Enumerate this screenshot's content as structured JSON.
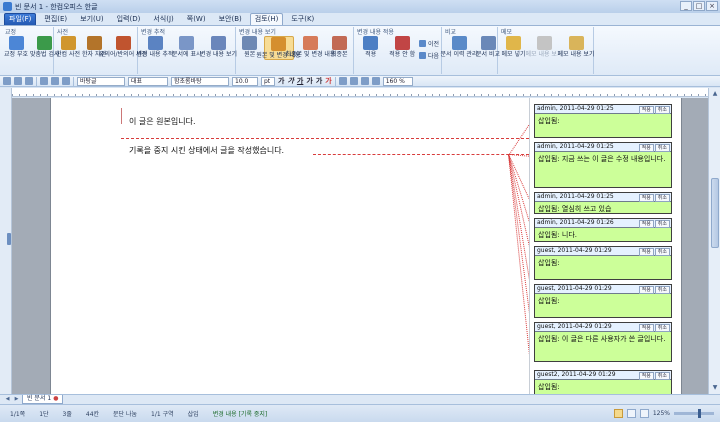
{
  "window": {
    "title": "빈 문서 1 - 한컴오피스 한글",
    "controls": [
      "_",
      "□",
      "×"
    ]
  },
  "menu": [
    {
      "label": "파일(F)",
      "kind": "file"
    },
    {
      "label": "편집(E)"
    },
    {
      "label": "보기(U)"
    },
    {
      "label": "입력(D)"
    },
    {
      "label": "서식(J)"
    },
    {
      "label": "쪽(W)"
    },
    {
      "label": "보안(B)"
    },
    {
      "label": "검토(H)",
      "kind": "active"
    },
    {
      "label": "도구(K)"
    }
  ],
  "ribbon": {
    "groups": [
      {
        "label": "교정",
        "buttons": [
          {
            "label": "교정 부호",
            "icon": "proof-mark-icon",
            "color": "#4c86d6"
          },
          {
            "label": "맞춤법 검사",
            "icon": "spellcheck-icon",
            "color": "#3b9a4a"
          }
        ]
      },
      {
        "label": "사전",
        "buttons": [
          {
            "label": "한컴 사전",
            "icon": "dictionary-icon",
            "color": "#d0962e"
          },
          {
            "label": "한자 자전",
            "icon": "hanja-dictionary-icon",
            "color": "#b3742a"
          },
          {
            "label": "유의어/반의어 사전",
            "icon": "thesaurus-icon",
            "color": "#c0542f"
          }
        ]
      },
      {
        "label": "변경 추적",
        "buttons": [
          {
            "label": "변경 내용 추적",
            "icon": "track-changes-icon",
            "color": "#5b83c2"
          },
          {
            "label": "문서에 표시",
            "icon": "show-in-document-icon",
            "color": "#7a96c7"
          },
          {
            "label": "변경 내용 보기",
            "icon": "view-changes-icon",
            "color": "#6a86bb"
          }
        ]
      },
      {
        "label": "변경 내용 보기",
        "buttons": [
          {
            "label": "원본",
            "icon": "original-icon",
            "color": "#6e89b4"
          },
          {
            "label": "원본 및 변경 내용",
            "icon": "original-and-changes-icon",
            "color": "#d58f2e",
            "selected": true
          },
          {
            "label": "최종본 및 변경 내용",
            "icon": "final-and-changes-icon",
            "color": "#d67b5a"
          },
          {
            "label": "최종본",
            "icon": "final-icon",
            "color": "#c26a55"
          }
        ]
      },
      {
        "label": "변경 내용 적용",
        "buttons": [
          {
            "label": "적용",
            "icon": "apply-icon",
            "color": "#4d7fc4"
          },
          {
            "label": "적용 안 함",
            "icon": "reject-icon",
            "color": "#c14545"
          }
        ],
        "minis": [
          {
            "label": "이전",
            "icon": "previous-icon"
          },
          {
            "label": "다음",
            "icon": "next-icon"
          }
        ]
      },
      {
        "label": "비교",
        "buttons": [
          {
            "label": "문서 이력 관리",
            "icon": "history-icon",
            "color": "#5a8ac8"
          },
          {
            "label": "문서 비교",
            "icon": "compare-icon",
            "color": "#6a88b8"
          }
        ]
      },
      {
        "label": "메모",
        "buttons": [
          {
            "label": "메모 넣기",
            "icon": "memo-insert-icon",
            "color": "#e0b64a"
          },
          {
            "label": "메모 내용 보기",
            "icon": "memo-view-icon",
            "color": "#c4c4c4",
            "disabled": true
          },
          {
            "label": "메모 내용 보기",
            "icon": "memo-show-icon",
            "color": "#d9b45a"
          }
        ]
      }
    ]
  },
  "format_bar": {
    "style": "바탕글",
    "lang": "대표",
    "font": "함초롬바탕",
    "size": "10.0",
    "unit": "pt",
    "bold_labels": [
      "가",
      "가",
      "가",
      "가",
      "가",
      "가"
    ],
    "spacing": "160 %"
  },
  "document": {
    "lines": [
      "이 글은 원본입니다.",
      "기록을 중지 시킨 상태에서 글을 작성했습니다."
    ]
  },
  "memos": [
    {
      "author": "admin",
      "date": "2011-04-29 01:25",
      "text": "삽입됨:",
      "buttons": [
        "적용",
        "취소"
      ]
    },
    {
      "author": "admin",
      "date": "2011-04-29 01:25",
      "text": "삽입됨: 지금 쓰는 이 글은 수정 내용입니다.",
      "buttons": [
        "적용",
        "취소"
      ]
    },
    {
      "author": "admin",
      "date": "2011-04-29 01:25",
      "text": "삽입됨: 열심히 쓰고 있습",
      "buttons": [
        "적용",
        "취소"
      ]
    },
    {
      "author": "admin",
      "date": "2011-04-29 01:26",
      "text": "삽입됨: 니다.",
      "buttons": [
        "적용",
        "취소"
      ]
    },
    {
      "author": "guest",
      "date": "2011-04-29 01:29",
      "text": "삽입됨:",
      "buttons": [
        "적용",
        "취소"
      ]
    },
    {
      "author": "guest",
      "date": "2011-04-29 01:29",
      "text": "삽입됨:",
      "buttons": [
        "적용",
        "취소"
      ]
    },
    {
      "author": "guest",
      "date": "2011-04-29 01:29",
      "text": "삽입됨: 이 글은 다른 사용자가 쓴 글입니다.",
      "buttons": [
        "적용",
        "취소"
      ]
    },
    {
      "author": "guest2",
      "date": "2011-04-29 01:29",
      "text": "삽입됨:",
      "buttons": [
        "적용",
        "취소"
      ]
    }
  ],
  "doc_tabs": [
    {
      "label": "빈 문서 1"
    }
  ],
  "status": {
    "page": "1/1쪽",
    "section": "1단",
    "line": "3줄",
    "column": "44칸",
    "break": "문단 나눔",
    "area": "1/1 구역",
    "insert": "삽입",
    "track": "변경 내용 [기록 중지]",
    "zoom": "125%"
  },
  "colors": {
    "memo_bg": "#ccff99",
    "memo_header": "#e5f1ff",
    "track_line": "#d83c3c"
  }
}
